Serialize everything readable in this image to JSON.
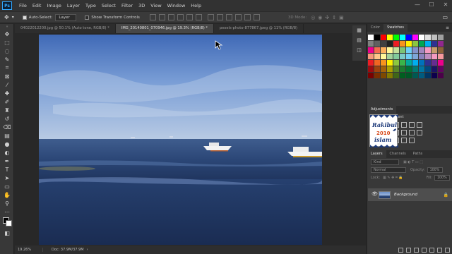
{
  "app": {
    "logo_text": "Ps"
  },
  "menu": [
    "File",
    "Edit",
    "Image",
    "Layer",
    "Type",
    "Select",
    "Filter",
    "3D",
    "View",
    "Window",
    "Help"
  ],
  "options_bar": {
    "auto_select_label": "Auto-Select:",
    "auto_select_target": "Layer",
    "transform_controls_label": "Show Transform Controls",
    "mode_3d_label": "3D Mode:"
  },
  "doc_tabs": [
    {
      "label": "04022012200.jpg @ 50.1% (Auto tone, RGB/8) *",
      "active": false
    },
    {
      "label": "IMG_20140801_070946.jpg @ 19.3% (RGB/8) *",
      "active": true
    },
    {
      "label": "pexels-photo-877867.jpeg @ 11% (RGB/8)",
      "active": false
    }
  ],
  "status_bar": {
    "zoom": "19.26%",
    "doc_size": "Doc: 37.9M/37.9M"
  },
  "panels": {
    "color_tab": "Color",
    "swatches_tab": "Swatches",
    "adjustments_tab": "Adjustments",
    "adjustments_add_label": "Add an adjustment",
    "layers_tab": "Layers",
    "channels_tab": "Channels",
    "paths_tab": "Paths",
    "kind_filter": "Kind",
    "blend_mode": "Normal",
    "opacity_label": "Opacity:",
    "opacity_value": "100%",
    "lock_label": "Lock:",
    "fill_label": "Fill:",
    "fill_value": "100%"
  },
  "layers": [
    {
      "name": "Background",
      "visible": true,
      "locked": true
    }
  ],
  "watermark": {
    "line1": "Rakibul",
    "line2": "2010",
    "line3": "islam"
  },
  "swatch_colors": [
    "#ffffff",
    "#000000",
    "#ff0000",
    "#ffff00",
    "#00ff00",
    "#00ffff",
    "#0000ff",
    "#ff00ff",
    "#ffffff",
    "#e0e0e0",
    "#c0c0c0",
    "#a0a0a0",
    "#808080",
    "#606060",
    "#404040",
    "#202020",
    "#ed1c24",
    "#f7941d",
    "#fff200",
    "#8dc63f",
    "#00a651",
    "#00aeef",
    "#2e3192",
    "#92278f",
    "#ec008c",
    "#f26c4f",
    "#fbaf5d",
    "#fff799",
    "#c4df9b",
    "#7cc576",
    "#6dcff6",
    "#8393ca",
    "#a186be",
    "#f49ac1",
    "#c69c6e",
    "#8c6239",
    "#f7977a",
    "#fdc68a",
    "#fff79a",
    "#a3d39c",
    "#82ca9c",
    "#7accc8",
    "#6ecff6",
    "#7ea7d8",
    "#8781bd",
    "#bd8cbf",
    "#f49ac2",
    "#f6989d",
    "#ed1c24",
    "#f26522",
    "#f7941d",
    "#fff200",
    "#8dc73f",
    "#39b54a",
    "#00a99d",
    "#00aeef",
    "#0072bc",
    "#2e3192",
    "#662d91",
    "#ec008c",
    "#9e0b0f",
    "#a0410d",
    "#a36209",
    "#aba000",
    "#598527",
    "#1a7b30",
    "#007236",
    "#007a71",
    "#0076a3",
    "#004a80",
    "#1b1464",
    "#630460",
    "#790000",
    "#7b2e00",
    "#7d4900",
    "#827b00",
    "#406618",
    "#005e20",
    "#005826",
    "#005952",
    "#005b7f",
    "#003663",
    "#0d004c",
    "#4b0049"
  ]
}
